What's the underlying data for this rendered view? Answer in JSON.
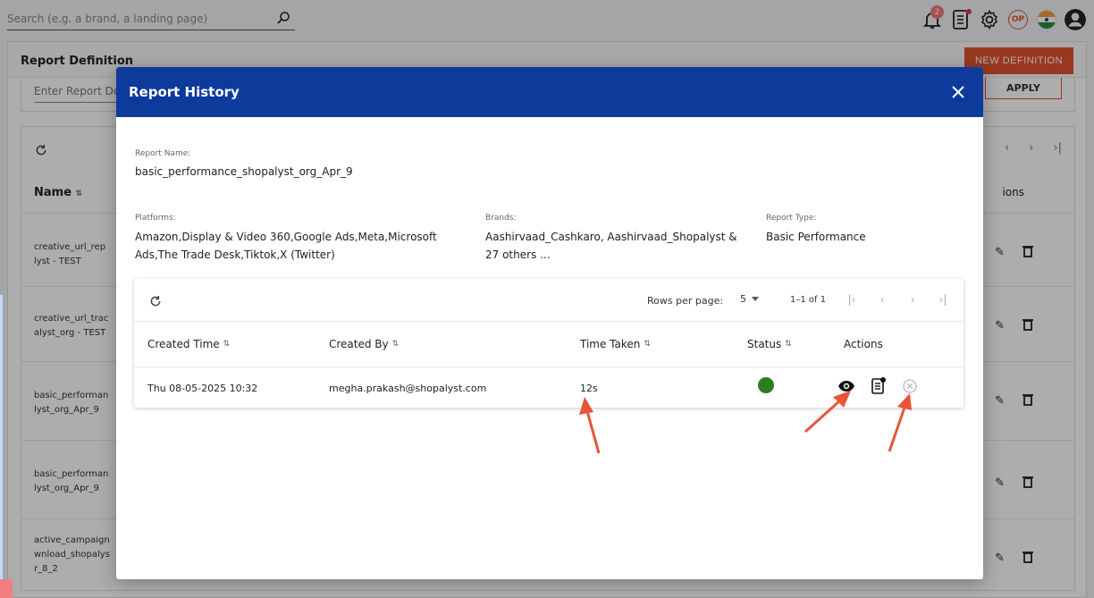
{
  "topbar": {
    "search_placeholder": "Search (e.g. a brand, a landing page)",
    "notification_count": "2",
    "profile_initials": "OP"
  },
  "background": {
    "title": "Report Definition",
    "new_button": "NEW DEFINITION",
    "filter_placeholder": "Enter Report De",
    "apply_button": "APPLY",
    "name_header": "Name",
    "actions_header": "ions",
    "rows": [
      {
        "line1": "creative_url_rep",
        "line2": "lyst - TEST"
      },
      {
        "line1": "creative_url_trac",
        "line2": "alyst_org - TEST"
      },
      {
        "line1": "basic_performan",
        "line2": "lyst_org_Apr_9"
      },
      {
        "line1": "basic_performan",
        "line2": "lyst_org_Apr_9"
      },
      {
        "line1": "active_campaign",
        "line2": "wnload_shopalys",
        "line3": "r_8_2"
      }
    ]
  },
  "modal": {
    "title": "Report History",
    "report_name_label": "Report Name:",
    "report_name": "basic_performance_shopalyst_org_Apr_9",
    "platforms_label": "Platforms:",
    "platforms_line1": "Amazon,Display & Video 360,Google Ads,Meta,Microsoft",
    "platforms_line2": "Ads,The Trade Desk,Tiktok,X (Twitter)",
    "brands_label": "Brands:",
    "brands_line1": "Aashirvaad_Cashkaro, Aashirvaad_Shopalyst &",
    "brands_line2": "27 others ...",
    "report_type_label": "Report Type:",
    "report_type": "Basic Performance",
    "table": {
      "rows_per_page_label": "Rows per page:",
      "rows_per_page": "5",
      "range": "1–1 of 1",
      "headers": {
        "created_time": "Created Time",
        "created_by": "Created By",
        "time_taken": "Time Taken",
        "status": "Status",
        "actions": "Actions"
      },
      "sort_icon": "⇅",
      "rows": [
        {
          "created_time": "Thu 08-05-2025 10:32",
          "created_by": "megha.prakash@shopalyst.com",
          "time_taken": "12s",
          "status_color": "#2e7d22"
        }
      ]
    }
  },
  "colors": {
    "modal_header": "#0e3a9c",
    "accent": "#e0532f",
    "annotation_arrow": "#e8543a"
  }
}
